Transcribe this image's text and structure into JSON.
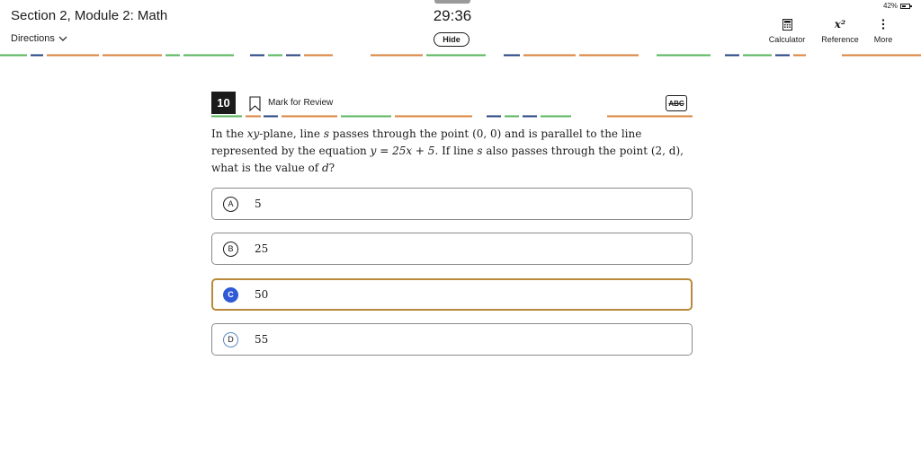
{
  "header": {
    "section_title": "Section 2, Module 2: Math",
    "directions_label": "Directions",
    "timer": "29:36",
    "hide_label": "Hide",
    "battery": "42%",
    "tools": {
      "calculator": "Calculator",
      "reference": "Reference",
      "more": "More"
    },
    "reference_icon_text": "x²"
  },
  "question": {
    "number": "10",
    "mark_label": "Mark for Review",
    "abc_label": "ABC",
    "stem_parts": {
      "p1": "In the ",
      "xy": "xy",
      "p2": "-plane, line ",
      "s1": "s",
      "p3": " passes through the point ",
      "pt1": "(0, 0)",
      "p4": " and is parallel to the line represented by the equation ",
      "eq": "y = 25x + 5",
      "p5": ". If line ",
      "s2": "s",
      "p6": " also passes through the point ",
      "pt2": "(2, d)",
      "p7": ", what is the value of ",
      "d": "d",
      "p8": "?"
    },
    "choices": [
      {
        "letter": "A",
        "value": "5"
      },
      {
        "letter": "B",
        "value": "25"
      },
      {
        "letter": "C",
        "value": "50"
      },
      {
        "letter": "D",
        "value": "55"
      }
    ],
    "selected": "C"
  },
  "colors": {
    "selected_border": "#b9893a",
    "selected_fill": "#2f5ad7",
    "dash_orange": "#d9823a",
    "dash_green": "#57b45c",
    "dash_blue": "#23407d"
  },
  "icons": {
    "directions": "chevron-down-icon",
    "mark": "bookmark-icon",
    "calculator": "calculator-icon",
    "reference": "reference-icon",
    "more": "more-vertical-icon",
    "battery": "battery-icon"
  }
}
